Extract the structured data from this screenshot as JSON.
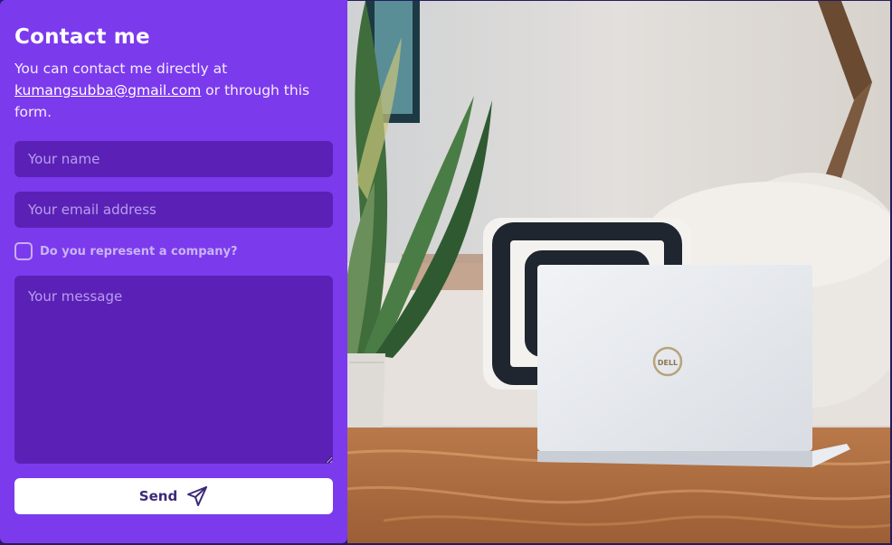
{
  "contact": {
    "title": "Contact me",
    "intro_prefix": "You can contact me directly at ",
    "email_link": "kumangsubba@gmail.com",
    "intro_suffix": " or through this form.",
    "name_placeholder": "Your name",
    "email_placeholder": "Your email address",
    "company_checkbox_label": "Do you represent a company?",
    "company_checked": false,
    "message_placeholder": "Your message",
    "send_label": "Send",
    "send_icon": "paper-plane-icon"
  },
  "photo": {
    "laptop_brand": "DELL"
  },
  "colors": {
    "panel": "#7c3aed",
    "field": "#5b21b6",
    "button": "#ffffff",
    "button_text": "#3b2a78"
  }
}
